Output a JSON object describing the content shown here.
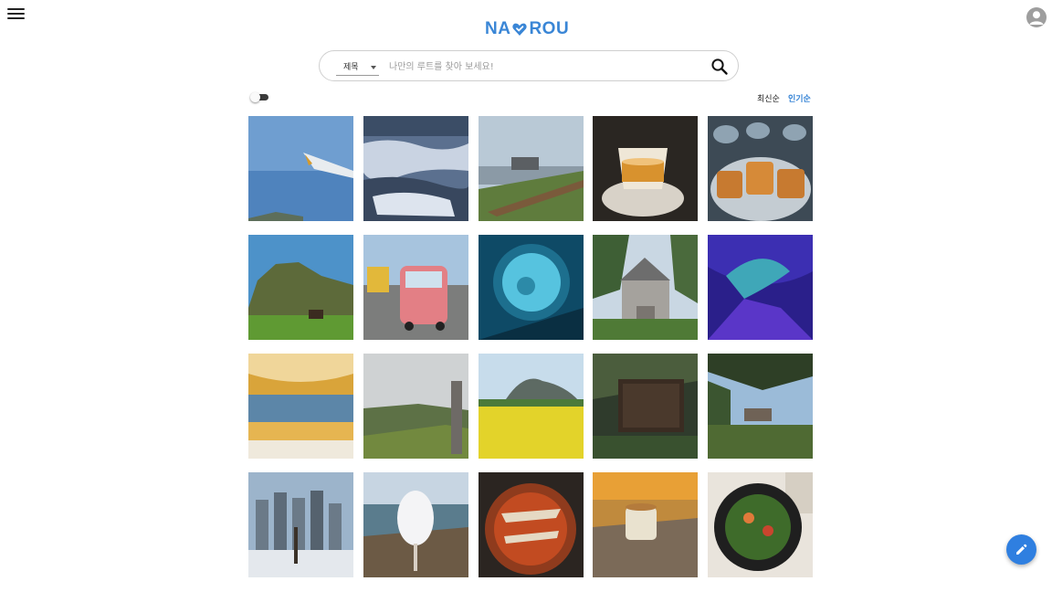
{
  "header": {
    "logo_left": "NA",
    "logo_right": "ROU",
    "brand_color": "#3a86d6",
    "menu_icon": "hamburger-menu-icon",
    "profile_icon": "account-circle-icon"
  },
  "search": {
    "filter_value": "제목",
    "placeholder": "나만의 루트를 찾아 보세요!",
    "search_icon": "search-icon"
  },
  "controls": {
    "toggle_state": "off",
    "sort_latest": "최신순",
    "sort_popular": "인기순",
    "active_sort": "인기순"
  },
  "gallery": {
    "tiles": [
      {
        "subject": "airplane wing over sky"
      },
      {
        "subject": "snowy rocky coast"
      },
      {
        "subject": "coastal path with fence"
      },
      {
        "subject": "pudding dessert on plate"
      },
      {
        "subject": "fried pork cutlet"
      },
      {
        "subject": "sea cliff with horse"
      },
      {
        "subject": "pink tuk-tuk on road"
      },
      {
        "subject": "aquarium porthole"
      },
      {
        "subject": "old western-style house"
      },
      {
        "subject": "blue fish projection art"
      },
      {
        "subject": "market food stall"
      },
      {
        "subject": "grass hill with stone marker"
      },
      {
        "subject": "canola flowers and mountain"
      },
      {
        "subject": "arboretum wooden sign"
      },
      {
        "subject": "pine trees and pavilion"
      },
      {
        "subject": "apartment towers in snow"
      },
      {
        "subject": "cotton candy by the river"
      },
      {
        "subject": "spicy stir-fried dish"
      },
      {
        "subject": "coffee cup on table"
      },
      {
        "subject": "salad bowl"
      }
    ]
  },
  "fab": {
    "icon": "edit-pencil-icon",
    "color": "#2f7fe0"
  }
}
